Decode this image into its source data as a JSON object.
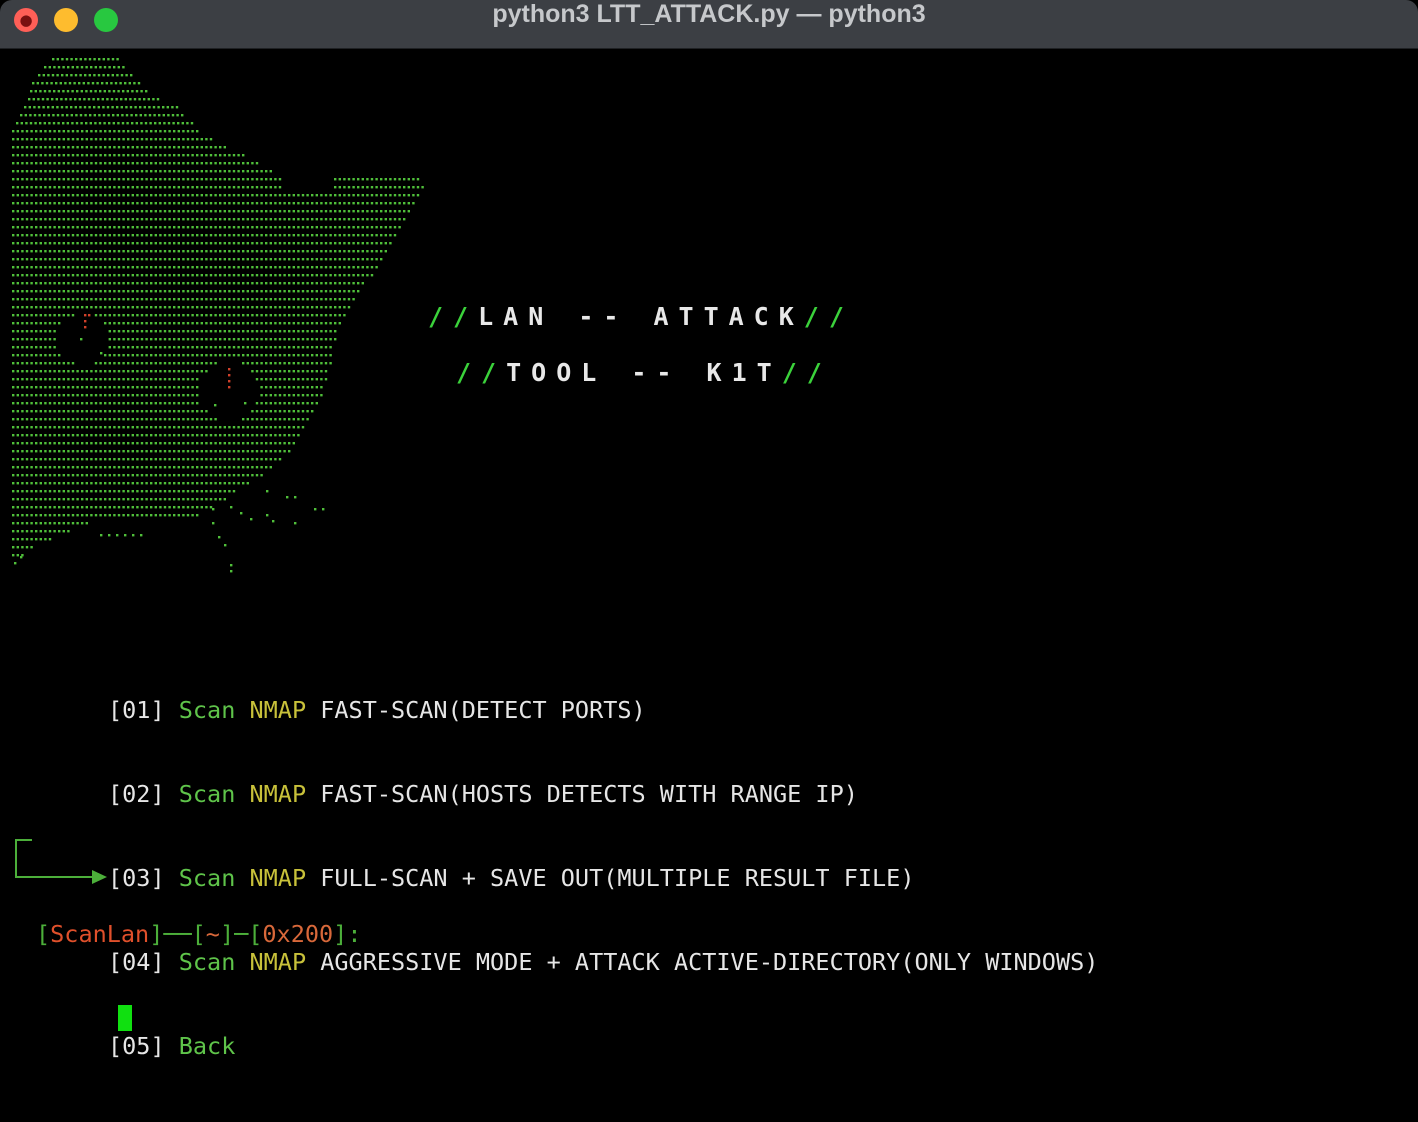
{
  "window": {
    "title": "python3 LTT_ATTACK.py — python3"
  },
  "banner": {
    "line1_text": "LAN -- ATTACK",
    "line2_text": "TOOL -- K1T",
    "slashes": "//"
  },
  "menu": {
    "items": [
      {
        "num": "[01]",
        "word1": "Scan",
        "word2": "NMAP",
        "desc": "FAST-SCAN(DETECT PORTS)"
      },
      {
        "num": "[02]",
        "word1": "Scan",
        "word2": "NMAP",
        "desc": "FAST-SCAN(HOSTS DETECTS WITH RANGE IP)"
      },
      {
        "num": "[03]",
        "word1": "Scan",
        "word2": "NMAP",
        "desc": "FULL-SCAN + SAVE OUT(MULTIPLE RESULT FILE)"
      },
      {
        "num": "[04]",
        "word1": "Scan",
        "word2": "NMAP",
        "desc": "AGGRESSIVE MODE + ATTACK ACTIVE-DIRECTORY(ONLY WINDOWS)"
      },
      {
        "num": "[05]",
        "word1": "Back",
        "word2": "",
        "desc": ""
      }
    ]
  },
  "prompt": {
    "context": "ScanLan",
    "dir": "~",
    "code": "0x200",
    "suffix": ":"
  },
  "colors": {
    "art_green": "#4fbf3a",
    "art_red": "#d0402a",
    "cursor": "#10e010"
  }
}
